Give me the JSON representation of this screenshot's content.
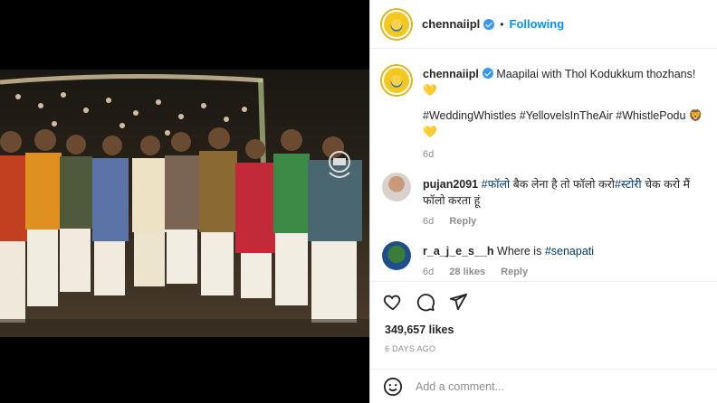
{
  "post": {
    "username": "chennaiipl",
    "follow_label": "Following",
    "caption_text": "Maapilai with Thol Kodukkum thozhans! 💛",
    "hashtags": "#WeddingWhistles #YellovelsInTheAir #WhistlePodu 🦁💛",
    "caption_age": "6d",
    "likes": "349,657 likes",
    "posted_ago": "6 DAYS AGO",
    "add_comment_placeholder": "Add a comment..."
  },
  "comments": [
    {
      "username": "pujan2091",
      "text_pre": "",
      "tag1": "#फॉलो",
      "text_mid": " बैक लेना है तो फॉलो करो",
      "tag2": "#स्टोरी",
      "text_post": " चेक करो मैं फॉलो करता हूं",
      "age": "6d",
      "reply": "Reply"
    },
    {
      "username": "r_a_j_e_s__h",
      "text_pre": " Where is ",
      "tag1": "#senapati",
      "age": "6d",
      "likes": "28 likes",
      "reply": "Reply"
    }
  ],
  "icons": [
    "heart-icon",
    "comment-icon",
    "share-icon",
    "emoji-icon",
    "verified-badge-icon"
  ],
  "colors": {
    "link": "#0095f6",
    "hashtag": "#00376b",
    "muted": "#8e8e8e",
    "text": "#262626"
  }
}
